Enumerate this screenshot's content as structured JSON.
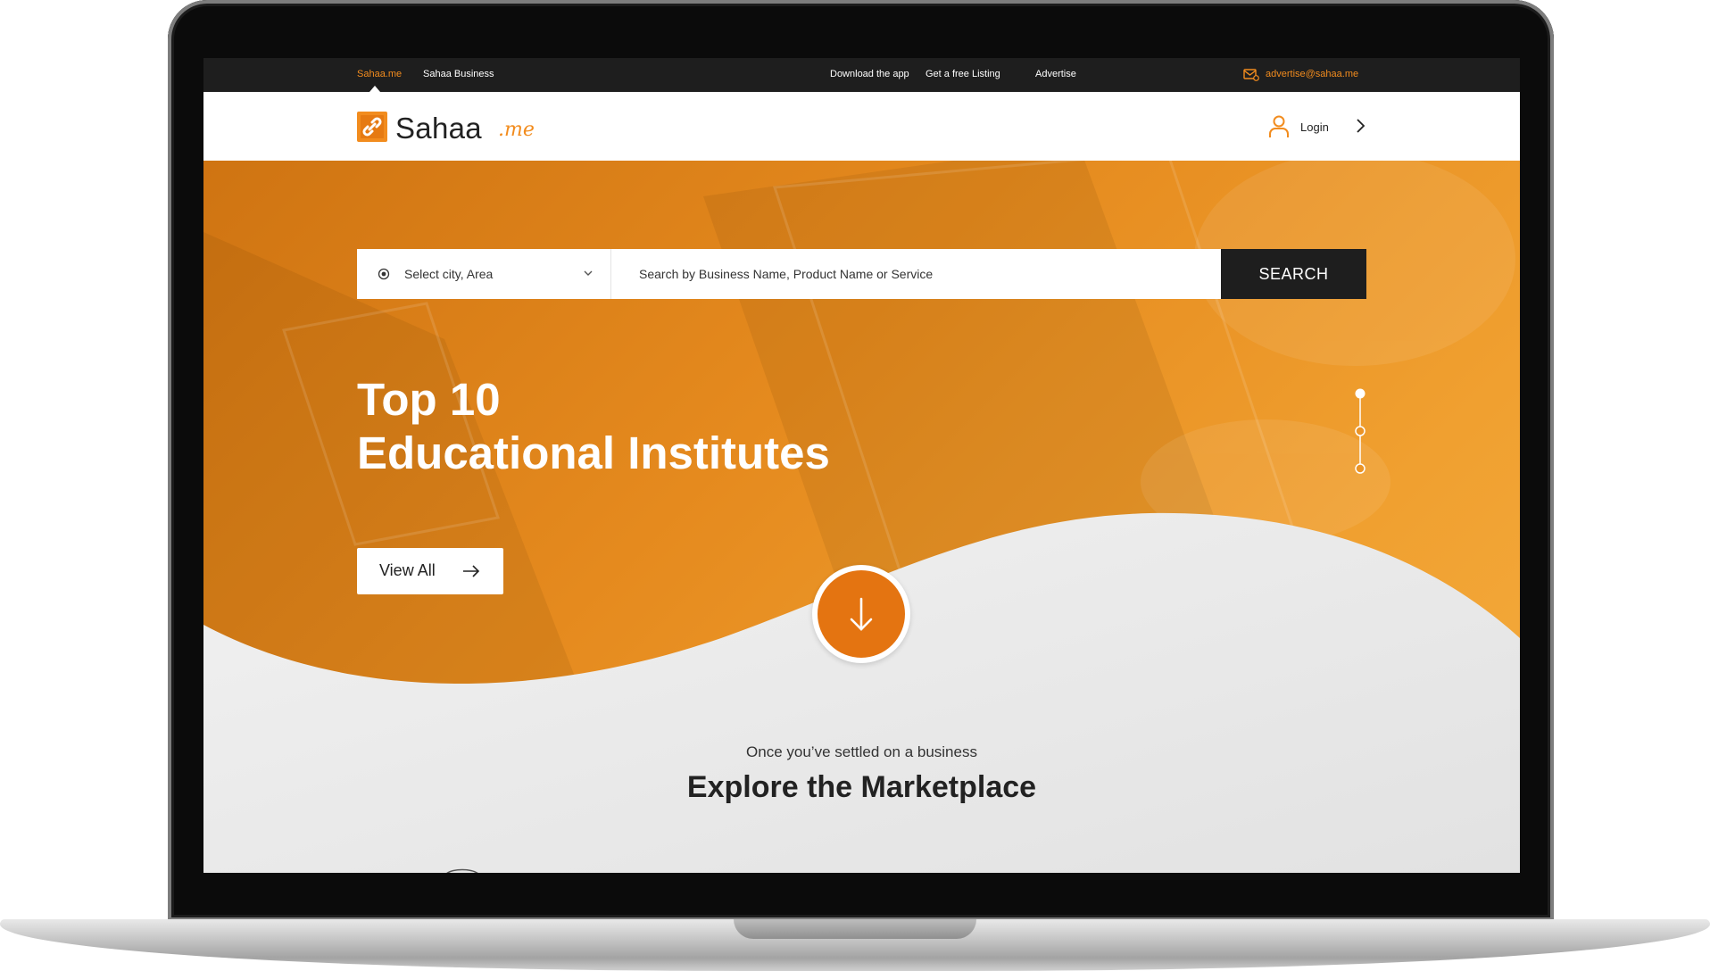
{
  "topbar": {
    "brand_link": "Sahaa.me",
    "business_link": "Sahaa Business",
    "download_link": "Download the app",
    "listing_link": "Get a free Listing",
    "advertise_link": "Advertise",
    "email": "advertise@sahaa.me",
    "icons": {
      "mail": "mail-icon"
    }
  },
  "header": {
    "logo_text": "Sahaa",
    "logo_suffix": ".me",
    "login_label": "Login",
    "icons": {
      "logo": "link-logo-icon",
      "user": "user-icon",
      "next": "chevron-right-icon"
    }
  },
  "search": {
    "city_placeholder": "Select city, Area",
    "query_placeholder": "Search by Business Name, Product Name or Service",
    "button_label": "SEARCH",
    "icons": {
      "location": "location-target-icon",
      "dropdown": "chevron-down-icon"
    }
  },
  "hero": {
    "title_line1": "Top 10",
    "title_line2": "Educational Institutes",
    "cta_label": "View All",
    "slides_total": 3,
    "active_slide": 1,
    "icons": {
      "cta": "arrow-right-icon",
      "scroll": "arrow-down-icon"
    }
  },
  "explore": {
    "subtitle": "Once you’ve settled on a business",
    "title": "Explore the Marketplace"
  },
  "colors": {
    "accent": "#f28c1e",
    "accent_dark": "#e47411",
    "dark": "#1e1e1e",
    "text": "#222222",
    "section_bg": "#efefef"
  }
}
